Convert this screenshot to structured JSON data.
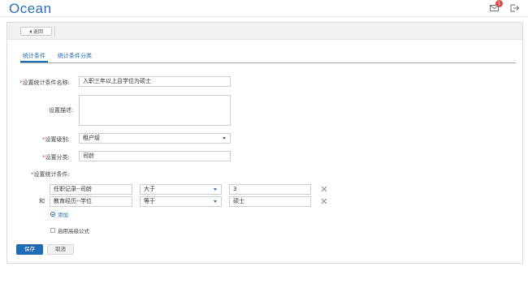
{
  "header": {
    "logo": "Ocean",
    "mail_badge": "1"
  },
  "toolbar": {
    "back_label": "返回"
  },
  "tabs": [
    {
      "label": "统计条件",
      "active": true
    },
    {
      "label": "统计条件分类",
      "active": false
    }
  ],
  "form": {
    "name": {
      "required_mark": "*",
      "label": "设置统计条件名称:",
      "value": "入职三年以上且学位为硕士"
    },
    "description": {
      "label": "设置描述:",
      "value": ""
    },
    "level": {
      "required_mark": "*",
      "label": "设置级别:",
      "value": "租户级"
    },
    "category": {
      "required_mark": "*",
      "label": "设置分类:",
      "value": "司龄"
    },
    "conditions_label": {
      "required_mark": "*",
      "label": "设置统计条件:"
    },
    "conjunction": "和",
    "conditions": [
      {
        "field": "任职记录--司龄",
        "operator": "大于",
        "value": "3"
      },
      {
        "field": "教育经历--学位",
        "operator": "等于",
        "value": "硕士"
      }
    ],
    "add_label": "添加",
    "advanced_label": "启用高级公式"
  },
  "actions": {
    "save_label": "保存",
    "cancel_label": "取消"
  },
  "colors": {
    "brand": "#2b6fb5",
    "primary_button": "#1f6cb2",
    "required": "#d9534f",
    "badge": "#e04848"
  }
}
